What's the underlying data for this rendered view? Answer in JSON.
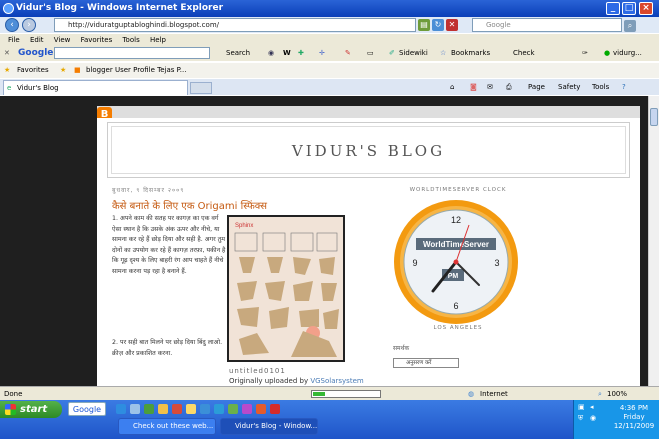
{
  "window": {
    "title": "Vidur's Blog - Windows Internet Explorer"
  },
  "address": {
    "url": "http://viduratguptabloghindi.blogspot.com/",
    "search_placeholder": "Google"
  },
  "menu": [
    "File",
    "Edit",
    "View",
    "Favorites",
    "Tools",
    "Help"
  ],
  "google_toolbar": {
    "logo": "Google",
    "search_label": "Search",
    "sidewiki": "Sidewiki",
    "bookmarks": "Bookmarks",
    "check": "Check",
    "user": "vidurg..."
  },
  "favorites": {
    "label": "Favorites",
    "link1": "blogger User Profile Tejas P..."
  },
  "tab": {
    "title": "Vidur's Blog",
    "tools": [
      "Page",
      "Safety",
      "Tools"
    ]
  },
  "blog": {
    "header_title": "VIDUR'S BLOG",
    "post_date": "बुधवार, ९ दिसम्बर २००९",
    "post_title": "कैसे बनाते के लिए एक Origami स्फिंक्स",
    "post_text": "1. अपने काम की सतह पर कागज़ का एक वर्ग ऐसा स्थान है कि उसके अंक ऊपर और नीचे, या सामना कर रहे हैं छोड़ दिया और सही है. अगर तुम दोनों का उपयोग कर रहे हैं कागज़ तरफ़ा, यकीन है कि गूढ़ दृश्य के लिए बाहरी रंग आप चाहते हैं नीचे सामना करना पड़ रहा है बनाने हैं.",
    "post_text2": "2. पर सही बात मिलने पर छोड़ दिया बिंदु लाओ. क्रीज़ और प्रकाशित करना.",
    "image_caption": "untitled0101",
    "uploaded_prefix": "Originally uploaded by ",
    "uploaded_user": "VGSolarsystem",
    "image_heading": "Sphinx",
    "clock_widget_title": "WORLDTIMESERVER CLOCK",
    "clock_brand": "WorldTimeServer",
    "clock_ampm": "PM",
    "clock_numbers": {
      "n12": "12",
      "n3": "3",
      "n6": "6",
      "n9": "9"
    },
    "clock_city": "LOS ANGELES",
    "sidebar_label": "समर्थक",
    "sidebar_badge": "अनुसरण करें"
  },
  "status": {
    "left": "Done",
    "zone": "Internet",
    "zoom": "100%"
  },
  "taskbar": {
    "start": "start",
    "google": "Google",
    "items": [
      "Check out these web...",
      "Vidur's Blog - Window..."
    ],
    "time": "4:36 PM",
    "day": "Friday",
    "date": "12/11/2009"
  }
}
